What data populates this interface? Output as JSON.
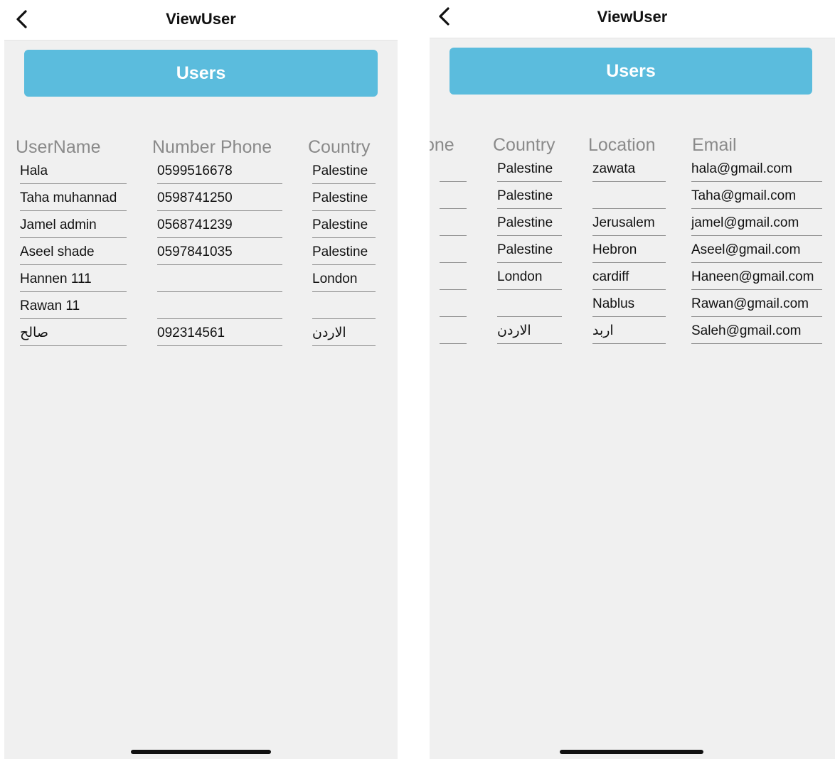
{
  "screens": [
    {
      "title": "ViewUser",
      "users_button": "Users",
      "headers": [
        "UserName",
        "Number Phone",
        "Country"
      ],
      "rows": [
        [
          "Hala",
          "0599516678",
          "Palestine"
        ],
        [
          "Taha muhannad",
          "0598741250",
          "Palestine"
        ],
        [
          "Jamel admin",
          "0568741239",
          "Palestine"
        ],
        [
          "Aseel shade",
          "0597841035",
          "Palestine"
        ],
        [
          "Hannen 111",
          "",
          "London"
        ],
        [
          "Rawan 11",
          "",
          ""
        ],
        [
          "صالح",
          "092314561",
          "الاردن"
        ]
      ]
    },
    {
      "title": "ViewUser",
      "users_button": "Users",
      "headers": [
        "one",
        "Country",
        "Location",
        "Email"
      ],
      "rows": [
        [
          "",
          "Palestine",
          "zawata",
          "hala@gmail.com"
        ],
        [
          "",
          "Palestine",
          "",
          "Taha@gmail.com"
        ],
        [
          "",
          "Palestine",
          "Jerusalem",
          "jamel@gmail.com"
        ],
        [
          "",
          "Palestine",
          "Hebron",
          "Aseel@gmail.com"
        ],
        [
          "",
          "London",
          "cardiff",
          "Haneen@gmail.com"
        ],
        [
          "",
          "",
          "Nablus",
          "Rawan@gmail.com"
        ],
        [
          "",
          "الاردن",
          "اربد",
          "Saleh@gmail.com"
        ]
      ]
    }
  ],
  "icons": {
    "back": "chevron-left-icon"
  },
  "colors": {
    "accent": "#5bbcdd",
    "content_bg": "#f0f0f0",
    "header_text": "#8a8a8a"
  }
}
